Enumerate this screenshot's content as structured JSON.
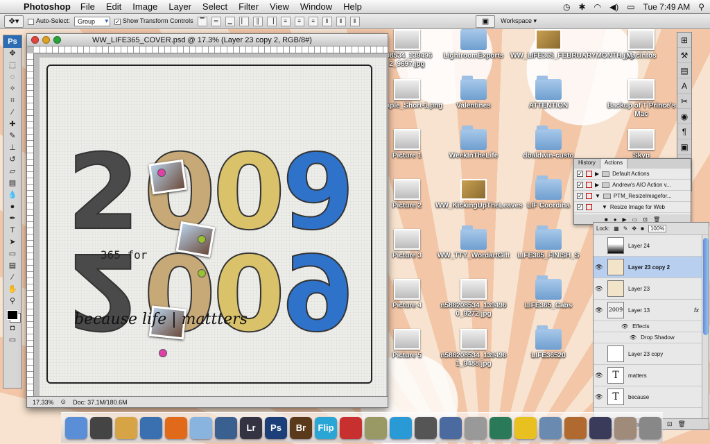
{
  "menubar": {
    "app": "Photoshop",
    "menus": [
      "File",
      "Edit",
      "Image",
      "Layer",
      "Select",
      "Filter",
      "View",
      "Window",
      "Help"
    ],
    "clock": "Tue 7:49 AM"
  },
  "options": {
    "auto_select_label": "Auto-Select:",
    "auto_select_value": "Group",
    "show_transform_label": "Show Transform Controls",
    "workspace_label": "Workspace"
  },
  "tools": {
    "ps_label": "Ps"
  },
  "document": {
    "title": "WW_LIFE365_COVER.psd @ 17.3% (Layer 23 copy 2, RGB/8#)",
    "zoom": "17.33%",
    "doc_info": "Doc: 37.1M/180.6M",
    "year_top": [
      "2",
      "0",
      "0",
      "9"
    ],
    "text_365": "365 for",
    "text_because": "because life | mattters"
  },
  "desktop_icons": [
    {
      "label": "208534_139496 2_9697.jpg",
      "type": "thumb"
    },
    {
      "label": "LightroomExports",
      "type": "folder"
    },
    {
      "label": "WW_LIFE365_FEBRUARYMONTH.jpg",
      "type": "scrap"
    },
    {
      "label": "Macintos",
      "type": "thumb"
    },
    {
      "label": "y_Staple_Short-1.png",
      "type": "thumb"
    },
    {
      "label": "Valentines",
      "type": "folder"
    },
    {
      "label": "ATTENTION",
      "type": "folder"
    },
    {
      "label": "Backup of T Prince's Mac",
      "type": "thumb"
    },
    {
      "label": "Picture 1",
      "type": "thumb"
    },
    {
      "label": "WeekInTheLife",
      "type": "folder"
    },
    {
      "label": "dbaldwin-custo",
      "type": "folder"
    },
    {
      "label": "Skyp",
      "type": "thumb"
    },
    {
      "label": "Picture 2",
      "type": "thumb"
    },
    {
      "label": "WW_KickingUpTheLeaves",
      "type": "scrap"
    },
    {
      "label": "LIF Coordina",
      "type": "folder"
    },
    {
      "label": "Picture 3",
      "type": "thumb"
    },
    {
      "label": "WW_TTY_WordartGift",
      "type": "folder"
    },
    {
      "label": "LIFE365_FINISH_S",
      "type": "folder"
    },
    {
      "label": "Picture 4",
      "type": "thumb"
    },
    {
      "label": "n586208534_139496 0_9272.jpg",
      "type": "thumb"
    },
    {
      "label": "LIFE365_Cabs",
      "type": "folder"
    },
    {
      "label": "Picture 5",
      "type": "thumb"
    },
    {
      "label": "n586208534_139496 1_9488.jpg",
      "type": "thumb"
    },
    {
      "label": "LIFE36520",
      "type": "folder"
    }
  ],
  "actions_panel": {
    "tabs": [
      "History",
      "Actions"
    ],
    "rows": [
      "Default Actions",
      "Andrew's AIO Action v...",
      "PTM_ResizeImagefor...",
      "Resize Image for Web"
    ]
  },
  "layers_panel": {
    "lock_label": "Lock:",
    "opacity": "100%",
    "fill": "100%",
    "layers": [
      {
        "name": "Layer 24",
        "selected": false,
        "fx": ""
      },
      {
        "name": "Layer 23 copy 2",
        "selected": true,
        "fx": ""
      },
      {
        "name": "Layer 23",
        "selected": false,
        "fx": ""
      },
      {
        "name": "Layer 13",
        "selected": false,
        "fx": "fx"
      },
      {
        "name": "Layer 23 copy",
        "selected": false,
        "fx": ""
      },
      {
        "name": "matters",
        "selected": false,
        "fx": "",
        "text": true
      },
      {
        "name": "because",
        "selected": false,
        "fx": "",
        "text": true
      }
    ],
    "effects_label": "Effects",
    "drop_shadow_label": "Drop Shadow"
  },
  "dock": {
    "apps": [
      "Finder",
      "Dashboard",
      "Address Book",
      "Preview",
      "Firefox",
      "Mail",
      "iPhoto",
      "Lr",
      "Ps",
      "Br",
      "Flip",
      "Folder",
      "Photos",
      "iTunes",
      "iMovie",
      "Spaces",
      "Network",
      "Time Machine",
      "Duck",
      "Downloads",
      "Keynote",
      "Photo Booth",
      "Stack",
      "Trash"
    ]
  }
}
